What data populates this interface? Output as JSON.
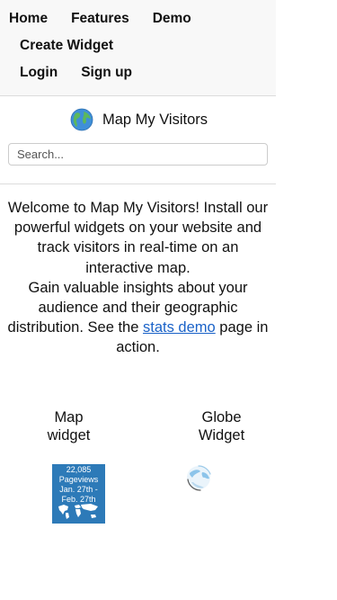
{
  "nav": {
    "home": "Home",
    "features": "Features",
    "demo": "Demo",
    "create_widget": "Create Widget",
    "login": "Login",
    "signup": "Sign up"
  },
  "brand": {
    "name": "Map My Visitors",
    "icon": "globe-icon"
  },
  "search": {
    "placeholder": "Search..."
  },
  "intro": {
    "part1": "Welcome to Map My Visitors! Install our powerful widgets on your website and track visitors in real-time on an interactive map.",
    "part2": "Gain valuable insights about your audience and their geographic distribution. See the",
    "link": "stats demo",
    "part3": "page in action."
  },
  "widgets": {
    "map": {
      "title": "Map widget",
      "count": "22,085",
      "label": "Pageviews",
      "range_start": "Jan. 27th -",
      "range_end": "Feb. 27th"
    },
    "globe": {
      "title": "Globe Widget"
    }
  },
  "colors": {
    "map_widget_bg": "#2d7ab8",
    "link": "#1a62c8"
  }
}
